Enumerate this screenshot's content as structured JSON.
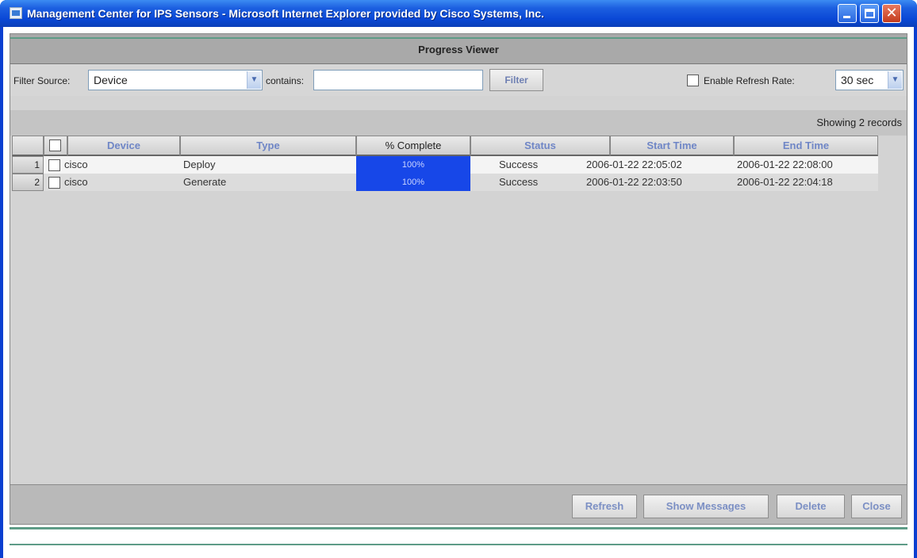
{
  "window": {
    "title": "Management Center for IPS Sensors - Microsoft Internet Explorer provided by Cisco Systems, Inc."
  },
  "viewer": {
    "title": "Progress Viewer"
  },
  "filter": {
    "source_label": "Filter Source:",
    "source_value": "Device",
    "contains_label": "contains:",
    "contains_value": "",
    "filter_button": "Filter",
    "refresh_label": "Enable Refresh Rate:",
    "refresh_value": "30 sec"
  },
  "records": {
    "summary": "Showing 2 records"
  },
  "table": {
    "columns": [
      "Device",
      "Type",
      "% Complete",
      "Status",
      "Start Time",
      "End Time"
    ],
    "rows": [
      {
        "num": "1",
        "device": "cisco",
        "type": "Deploy",
        "complete": "100%",
        "status": "Success",
        "start": "2006-01-22 22:05:02",
        "end": "2006-01-22 22:08:00"
      },
      {
        "num": "2",
        "device": "cisco",
        "type": "Generate",
        "complete": "100%",
        "status": "Success",
        "start": "2006-01-22 22:03:50",
        "end": "2006-01-22 22:04:18"
      }
    ]
  },
  "footer": {
    "refresh": "Refresh",
    "show_messages": "Show Messages",
    "delete": "Delete",
    "close": "Close"
  },
  "colors": {
    "titlebar": "#0a48d6",
    "progress": "#1747e8",
    "accent_line": "#5e9c87"
  }
}
